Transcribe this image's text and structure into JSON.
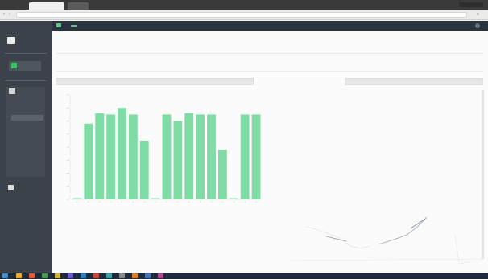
{
  "browser": {
    "tab_title": "",
    "address": ""
  },
  "header": {
    "logo_text": "",
    "logo_badge": "",
    "nav": [
      "",
      ""
    ]
  },
  "sidebar": {
    "brand": "",
    "active_item": "",
    "group_label": "",
    "items": [
      "",
      "",
      "",
      "",
      "",
      "",
      "",
      "",
      "",
      "",
      ""
    ],
    "bottom_item": ""
  },
  "page": {
    "title": "",
    "subtitle": "",
    "welcome": "",
    "top_right": "",
    "breadcrumb_prefix": "",
    "breadcrumb_current": "",
    "export_label": "",
    "sub_tabs": [
      "",
      ""
    ],
    "panel_headers": [
      "",
      "",
      ""
    ]
  },
  "stats": {
    "labels": [
      "",
      "",
      "",
      ""
    ],
    "values": [
      "",
      "",
      "",
      ""
    ]
  },
  "taskbar": {
    "clock": ""
  },
  "colors": {
    "accent_green": "#5cc98a",
    "bar_fill": "#7fdca5",
    "header_dark": "#2c3340",
    "sidebar_dark": "#3b4249"
  },
  "chart_data": {
    "type": "bar",
    "values": [
      1,
      58,
      66,
      65,
      70,
      65,
      45,
      1,
      65,
      60,
      66,
      65,
      65,
      38,
      1,
      65,
      65
    ],
    "ylim": [
      0,
      80
    ],
    "grid": false,
    "legend": "none",
    "title": "",
    "xlabel": "",
    "ylabel": ""
  }
}
